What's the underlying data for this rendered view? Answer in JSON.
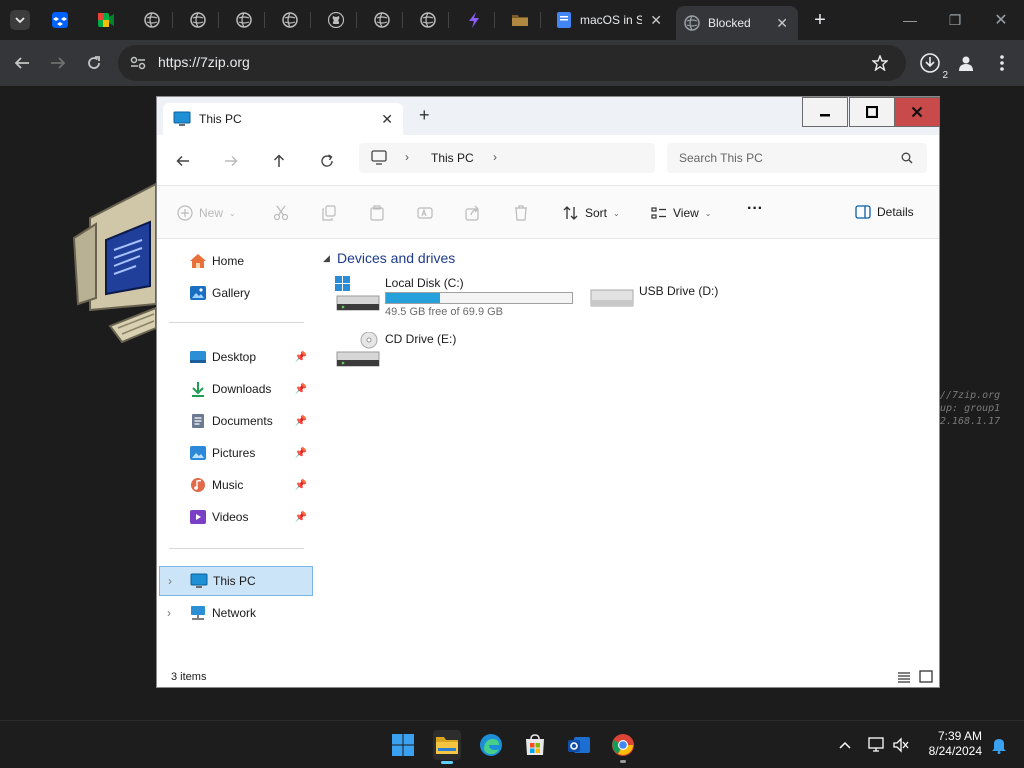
{
  "browser": {
    "tabs": [
      {
        "label": "macOS in S"
      },
      {
        "label": "Blocked"
      }
    ],
    "url": "https://7zip.org",
    "download_count": "2"
  },
  "remote": {
    "terminal_lines": [
      "//7zip.org",
      "up: group1",
      "2.168.1.17"
    ]
  },
  "explorer": {
    "tab_title": "This PC",
    "breadcrumb": [
      "This PC"
    ],
    "search_placeholder": "Search This PC",
    "commands": {
      "new": "New",
      "sort": "Sort",
      "view": "View",
      "more": "···",
      "details": "Details"
    },
    "sidebar": {
      "top": [
        {
          "label": "Home"
        },
        {
          "label": "Gallery"
        }
      ],
      "pinned": [
        {
          "label": "Desktop"
        },
        {
          "label": "Downloads"
        },
        {
          "label": "Documents"
        },
        {
          "label": "Pictures"
        },
        {
          "label": "Music"
        },
        {
          "label": "Videos"
        }
      ],
      "bottom": [
        {
          "label": "This PC",
          "selected": true
        },
        {
          "label": "Network"
        }
      ]
    },
    "section_title": "Devices and drives",
    "drives": [
      {
        "name": "Local Disk (C:)",
        "free": "49.5 GB free of 69.9 GB",
        "used_fraction": 0.29
      },
      {
        "name": "USB Drive (D:)"
      },
      {
        "name": "CD Drive (E:)"
      }
    ],
    "status": "3 items"
  },
  "taskbar": {
    "time": "7:39 AM",
    "date": "8/24/2024"
  },
  "colors": {
    "accent": "#26a0da",
    "close_red": "#c42b1c",
    "section_blue": "#1e3a8a"
  }
}
